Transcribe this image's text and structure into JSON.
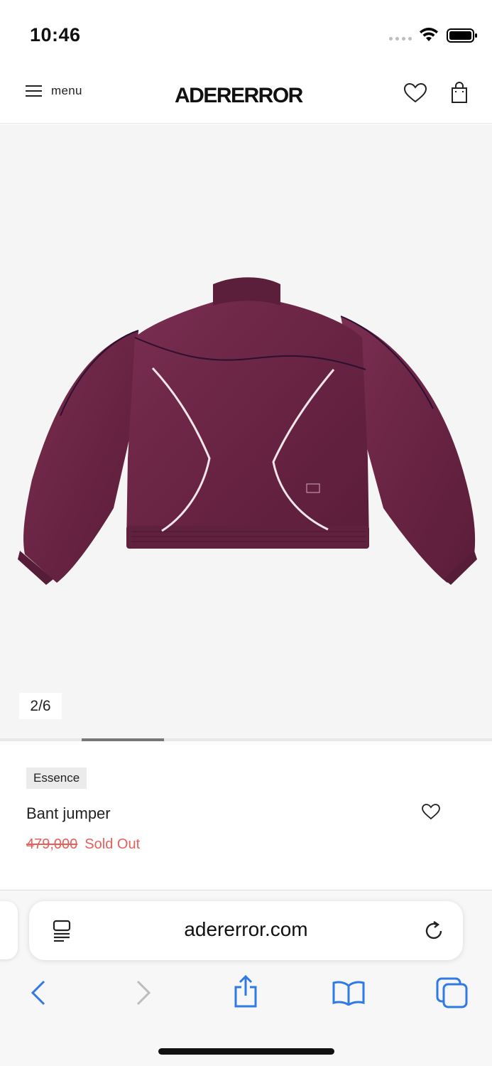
{
  "status_bar": {
    "time": "10:46"
  },
  "header": {
    "menu_label": "menu",
    "logo": "ADERERROR"
  },
  "gallery": {
    "counter": "2/6",
    "current": 2,
    "total": 6
  },
  "product": {
    "tag": "Essence",
    "name": "Bant jumper",
    "original_price": "479,000",
    "status": "Sold Out"
  },
  "browser": {
    "url": "adererror.com"
  },
  "colors": {
    "accent_price": "#e5605a",
    "jacket": "#6b2645",
    "background": "#f5f5f5",
    "link_blue": "#2f7ae5"
  },
  "icons": [
    "menu-icon",
    "heart-icon",
    "shopping-bag-icon",
    "reader-icon",
    "reload-icon",
    "back-icon",
    "forward-icon",
    "share-icon",
    "bookmarks-icon",
    "tabs-icon",
    "wifi-icon",
    "battery-icon"
  ]
}
